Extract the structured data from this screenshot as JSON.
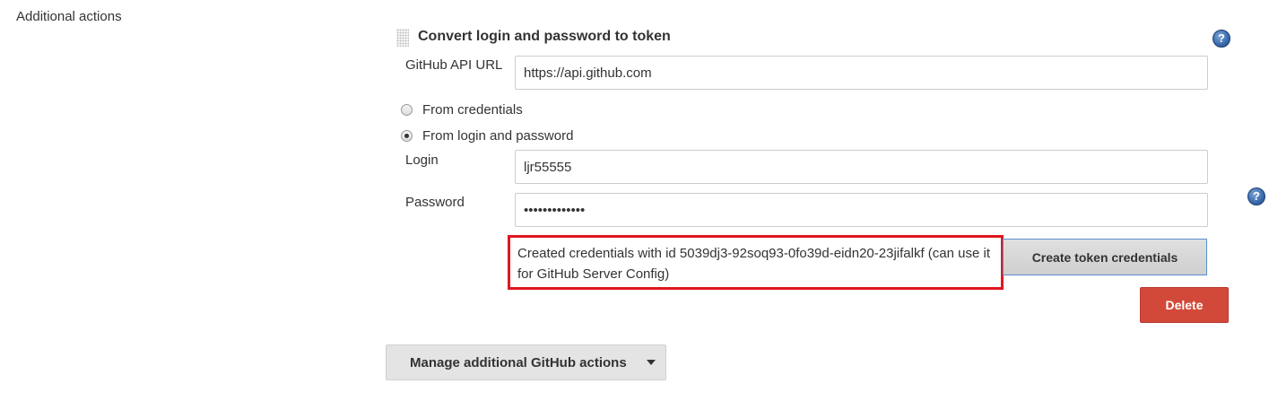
{
  "section_label": "Additional actions",
  "block": {
    "title": "Convert login and password to token",
    "help_icon": "help-icon"
  },
  "api_url": {
    "label": "GitHub API URL",
    "value": "https://api.github.com"
  },
  "radios": [
    {
      "label": "From credentials",
      "checked": false
    },
    {
      "label": "From login and password",
      "checked": true
    }
  ],
  "login": {
    "label": "Login",
    "value": "ljr55555"
  },
  "password": {
    "label": "Password",
    "value": "•••••••••••••"
  },
  "message": {
    "text": "Created credentials with id  5039dj3-92soq93-0fo39d-eidn20-23jifalkf (can use it for GitHub Server Config)",
    "highlight_color": "#e0171f"
  },
  "buttons": {
    "create_token": "Create token credentials",
    "delete": "Delete",
    "manage": "Manage additional GitHub actions"
  },
  "colors": {
    "delete_bg": "#d24939",
    "help_icon": "#3d6eb0"
  }
}
